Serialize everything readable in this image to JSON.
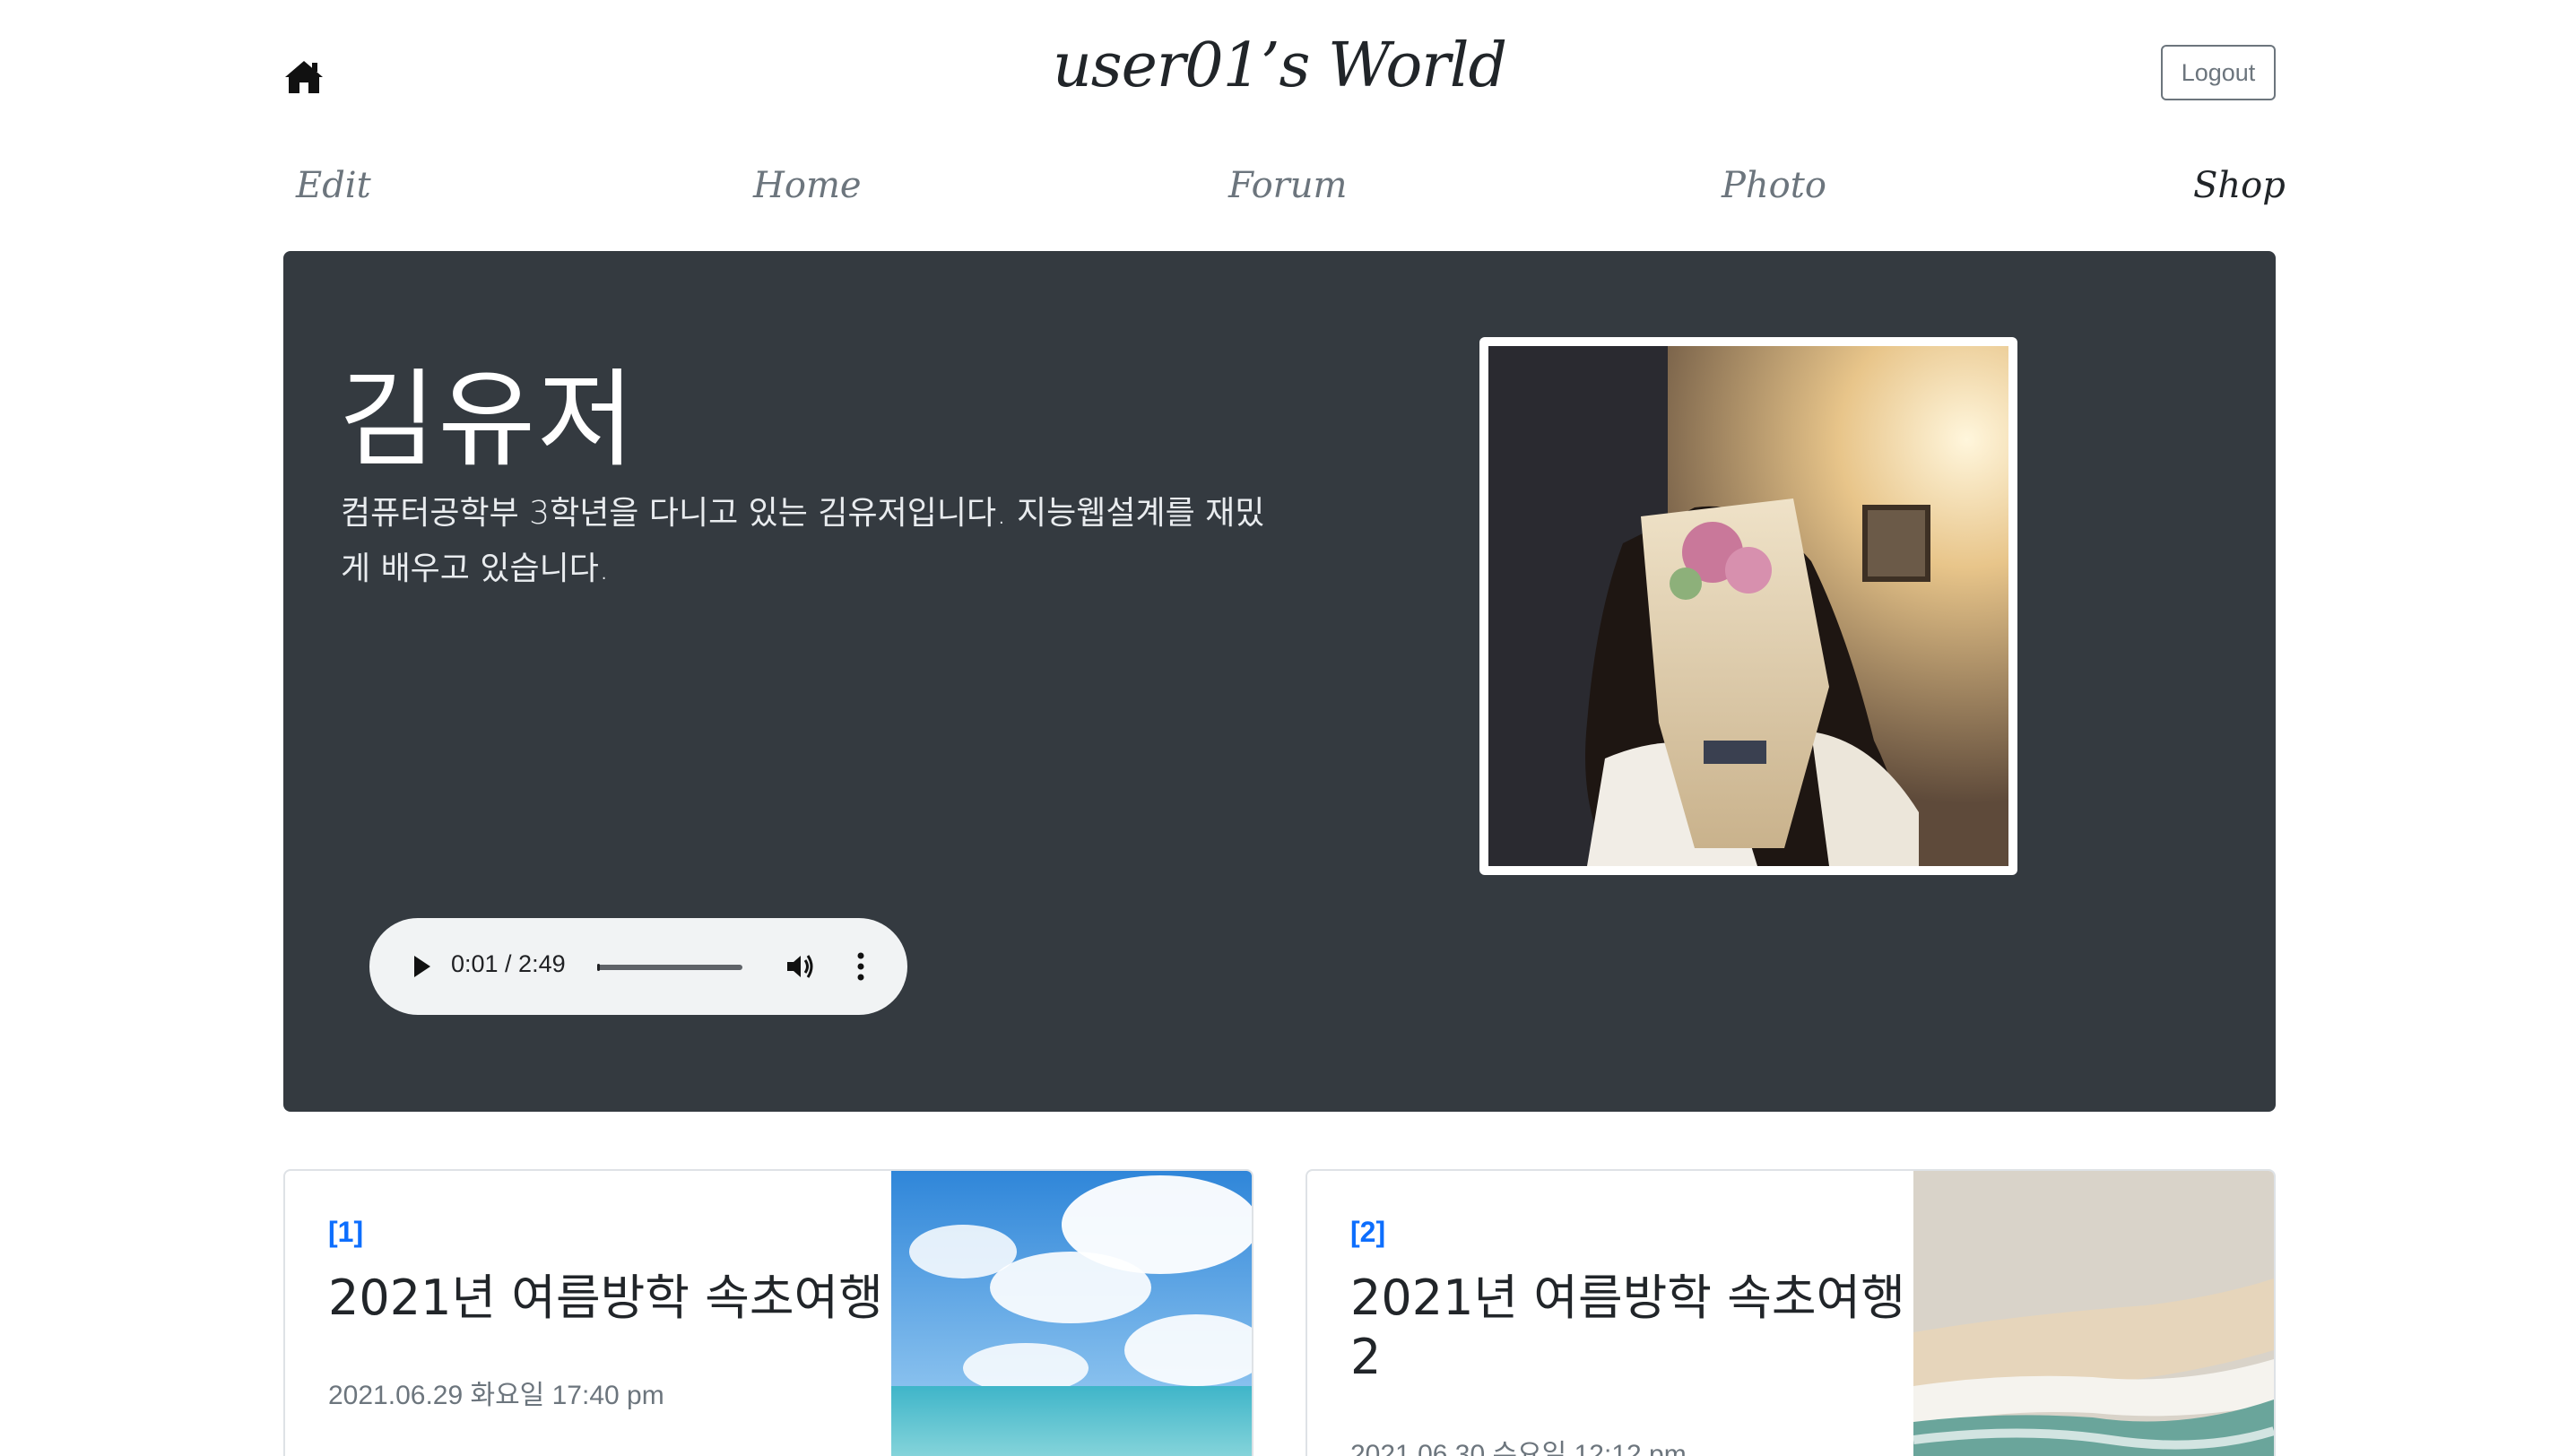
{
  "header": {
    "site_title": "user01’s World",
    "logout_label": "Logout"
  },
  "nav": {
    "items": [
      {
        "label": "Edit",
        "active": false
      },
      {
        "label": "Home",
        "active": false
      },
      {
        "label": "Forum",
        "active": false
      },
      {
        "label": "Photo",
        "active": false
      },
      {
        "label": "Shop",
        "active": true
      }
    ]
  },
  "hero": {
    "name": "김유저",
    "description": "컴퓨터공학부 3학년을 다니고 있는 김유저입니다. 지능웹설계를 재밌게 배우고 있습니다."
  },
  "audio": {
    "time": "0:01 / 2:49",
    "progress": 0.006
  },
  "cards": [
    {
      "number": "[1]",
      "title": "2021년 여름방학 속초여행",
      "date": "2021.06.29 화요일 17:40 pm"
    },
    {
      "number": "[2]",
      "title": "2021년 여름방학 속초여행 2",
      "date": "2021.06.30 수요일 12:12 pm"
    }
  ],
  "icons": {
    "home": "home-icon",
    "play": "play-icon",
    "volume": "volume-icon",
    "more": "more-vertical-icon"
  },
  "colors": {
    "hero_bg": "#343a40",
    "link_blue": "#0d6efd",
    "muted": "#6c757d"
  }
}
